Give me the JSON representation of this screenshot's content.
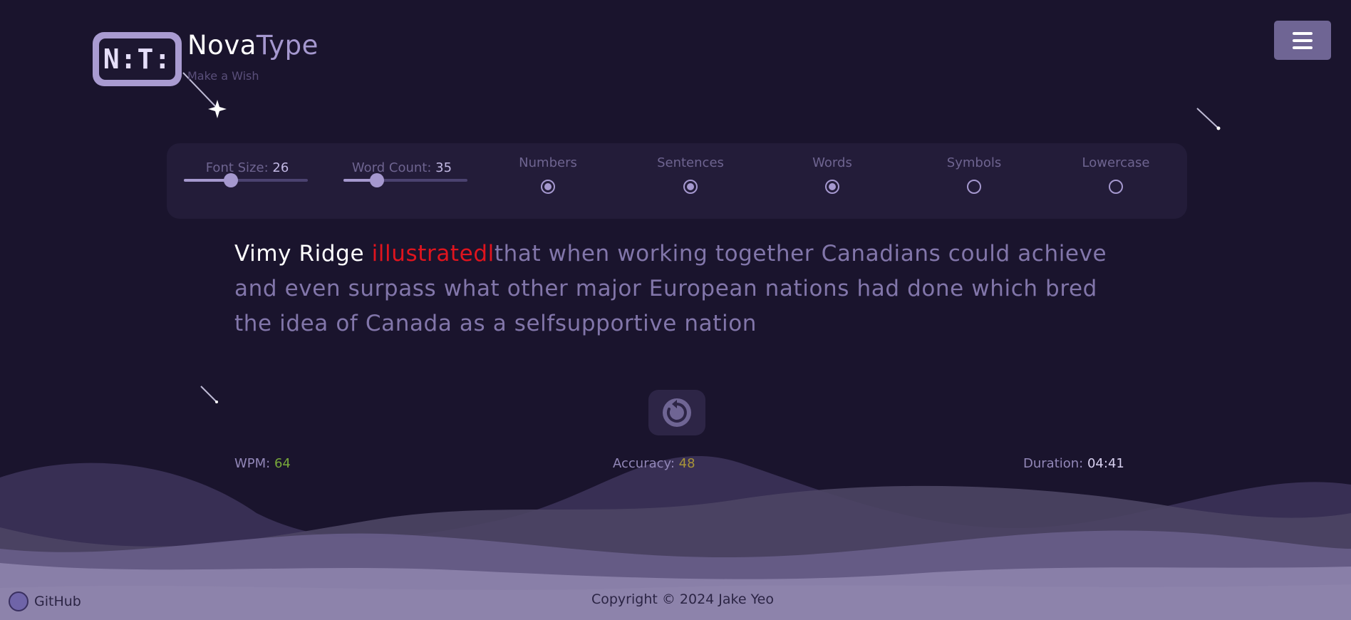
{
  "header": {
    "logo_text": "N:T:",
    "brand_nova": "Nova",
    "brand_type": "Type",
    "tagline": "Make a Wish",
    "menu_icon": "hamburger-icon"
  },
  "settings": {
    "font_size_label": "Font Size: ",
    "font_size_value": "26",
    "font_size_fraction": 0.38,
    "word_count_label": "Word Count: ",
    "word_count_value": "35",
    "word_count_fraction": 0.27,
    "options": [
      {
        "label": "Numbers",
        "checked": true
      },
      {
        "label": "Sentences",
        "checked": true
      },
      {
        "label": "Words",
        "checked": true
      },
      {
        "label": "Symbols",
        "checked": false
      },
      {
        "label": "Lowercase",
        "checked": false
      }
    ]
  },
  "typing": {
    "typed": "Vimy Ridge ",
    "wrong": "illustratedl",
    "remaining": "that when working together Canadians could achieve and even surpass what other major European nations had done which bred the idea of Canada as a selfsupportive nation"
  },
  "restart_icon": "restart-icon",
  "stats": {
    "wpm_label": "WPM: ",
    "wpm_value": "64",
    "accuracy_label": "Accuracy: ",
    "accuracy_value": "48",
    "duration_label": "Duration: ",
    "duration_value": "04:41"
  },
  "footer": {
    "github_label": "GitHub",
    "copyright": "Copyright © 2024 Jake Yeo"
  },
  "colors": {
    "background": "#1a142d",
    "accent": "#a598cf",
    "error": "#e0141e",
    "wpm": "#78a83a",
    "accuracy": "#a89438"
  }
}
